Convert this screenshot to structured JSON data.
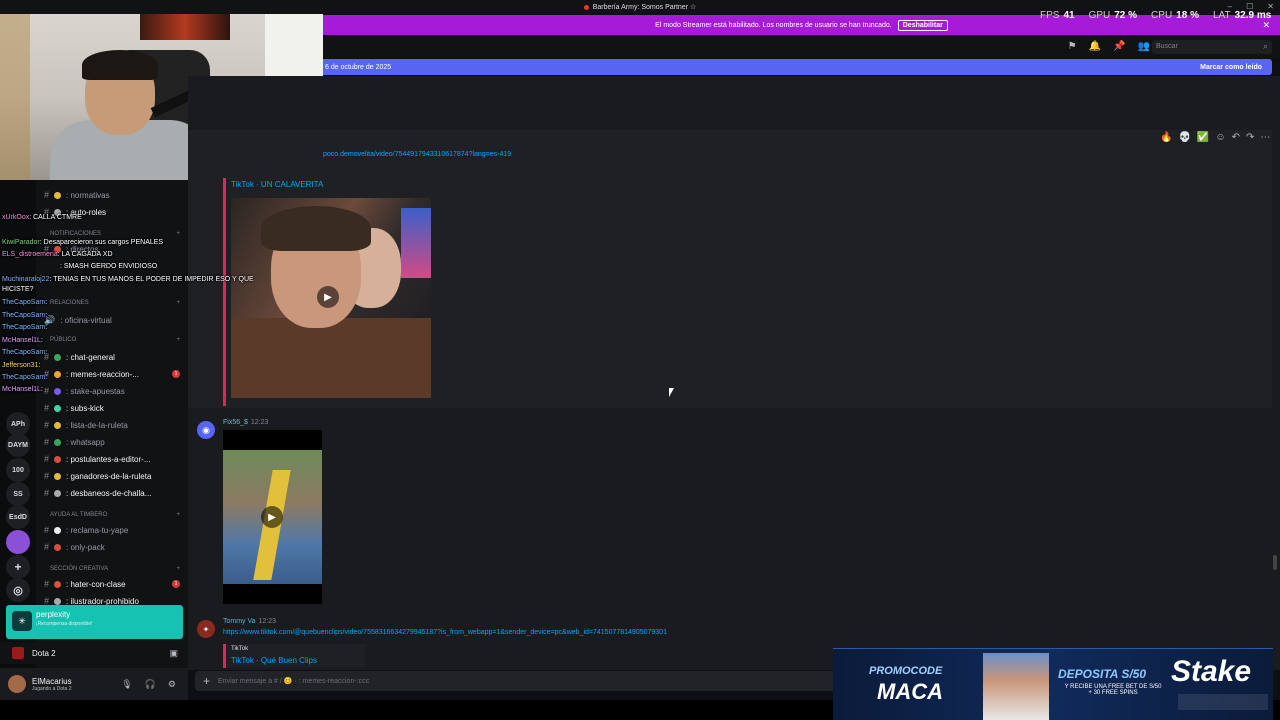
{
  "titlebar": {
    "title": "Barbería Army: Somos Partner ☆"
  },
  "perf": {
    "fps_label": "FPS",
    "fps": "41",
    "gpu_label": "GPU",
    "gpu": "72 %",
    "cpu_label": "CPU",
    "cpu": "18 %",
    "lat_label": "LAT",
    "lat": "32.9 ms"
  },
  "banner": {
    "text": "El modo Streamer está habilitado. Los nombres de usuario se han truncado.",
    "button": "Deshabilitar"
  },
  "header": {
    "search_placeholder": "Buscar"
  },
  "newbar": {
    "text": "6 de octubre de 2025",
    "mark_read": "Marcar como leído"
  },
  "messages": {
    "link1": "poco.demovelita/video/7544917943310617874?lang=es-419",
    "embed1_title": "TikTok · UN CALAVERITA",
    "user2": "Fix56_$",
    "time2": "12:23",
    "user3": "Tommy Va",
    "time3": "12:23",
    "link3": "https://www.tiktok.com/@quebuenclips/video/7558316634279945187?is_from_webapp=1&sender_device=pc&web_id=7415077814905079301",
    "embed3_provider": "TikTok",
    "embed3_title": "TikTok · Qué Buen Clips"
  },
  "input": {
    "placeholder": "Enviar mensaje a # / 😊 · : memes-reaccion-:ccc"
  },
  "sidebar": {
    "channels": [
      {
        "label": ": normativas"
      },
      {
        "label": ": auto-roles"
      },
      {
        "label": ": directos"
      },
      {
        "label": ": oficina-virtual"
      },
      {
        "label": ": chat-general"
      },
      {
        "label": ": memes-reaccion-..."
      },
      {
        "label": ": stake-apuestas"
      },
      {
        "label": ": subs-kick"
      },
      {
        "label": ": lista-de-la-ruleta"
      },
      {
        "label": ": whatsapp"
      },
      {
        "label": ": postulantes-a-editor-..."
      },
      {
        "label": ": ganadores-de-la-ruleta"
      },
      {
        "label": ": desbaneos-de-challa..."
      },
      {
        "label": ": reclama-tu-yape"
      },
      {
        "label": ": only-pack"
      },
      {
        "label": ": hater-con-clase"
      },
      {
        "label": ": ilustrador-prohibido"
      }
    ],
    "categories": {
      "notif": "NOTIFICACIONES",
      "relaciones": "RELACIONES",
      "publico": "PÚBLICO",
      "ayuda": "AYUDA AL TIMBERO",
      "creativa": "SECCIÓN CREATIVA"
    },
    "servers": [
      "APh",
      "DAYM",
      "100",
      "SS",
      "EsdD"
    ],
    "unread": [
      "1",
      "1"
    ],
    "perplexity": {
      "title": "perplexity",
      "sub": "¡Recompensa disponible!"
    },
    "game": "Dota 2",
    "user": {
      "name": "ElMacarius",
      "status": "Jugando a Dota 2"
    }
  },
  "overlay_chat": [
    {
      "name": "xUrkOox",
      "text": ": CALLA CTMRE"
    },
    {
      "name": "KiwiParador",
      "text": ": Desaparecieron sus cargos PENALES"
    },
    {
      "name": "ELS_distroemeria",
      "text": ": LA CAGADA XD"
    },
    {
      "name": "",
      "text": ": SMASH GERDO ENVIDIOSO"
    },
    {
      "name": "Muchinaraloj22",
      "text": ": TENIAS EN TUS MANOS EL PODER DE IMPEDIR ESO Y QUE"
    },
    {
      "name": "",
      "text": "HICISTE?"
    },
    {
      "name": "TheCapoSam",
      "text": ":"
    },
    {
      "name": "TheCapoSam",
      "text": ":"
    },
    {
      "name": "TheCapoSam",
      "text": ":"
    },
    {
      "name": "McHansel1L",
      "text": ":"
    },
    {
      "name": "TheCapoSam",
      "text": ":"
    },
    {
      "name": "Jefferson31",
      "text": ":"
    },
    {
      "name": "TheCapoSam",
      "text": ":"
    },
    {
      "name": "McHansel1L",
      "text": ":"
    }
  ],
  "ad": {
    "promo": "PROMOCODE",
    "code": "MACA",
    "deposit": "DEPOSITA S/50",
    "sub": "Y RECIBE UNA FREE BET DE S/50 + 30 FREE SPINS",
    "brand": "Stake"
  }
}
